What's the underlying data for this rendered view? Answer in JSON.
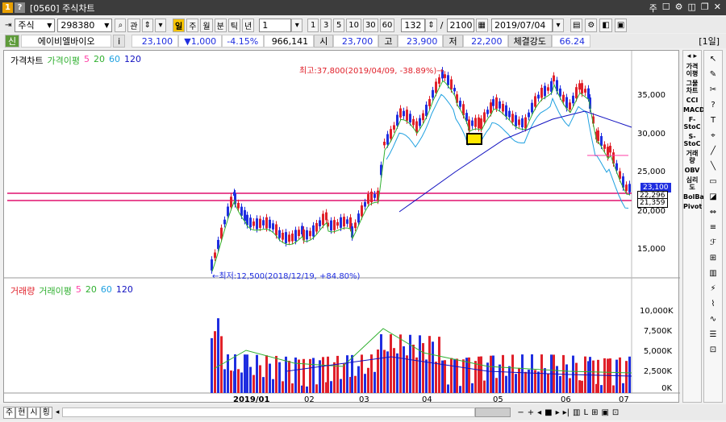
{
  "window": {
    "title": "[0560] 주식차트",
    "id_icon": "1",
    "help_icon": "?",
    "right_controls": [
      "주",
      "☐",
      "⚙",
      "◫",
      "❐",
      "✕"
    ]
  },
  "toolbar": {
    "market": "주식",
    "code": "298380",
    "quick_label": "관",
    "period_options": [
      "주",
      "월",
      "분",
      "틱",
      "년"
    ],
    "period_active": "일",
    "period_input": "1",
    "minute_options": [
      "1",
      "3",
      "5",
      "10",
      "30",
      "60"
    ],
    "count": "132",
    "total": "2100",
    "date": "2019/07/04"
  },
  "quote": {
    "badge": "신",
    "name": "에이비엘바이오",
    "info": "i",
    "price": "23,100",
    "change": "▼1,000",
    "rate": "-4.15%",
    "volume": "966,141",
    "open_label": "시",
    "open": "23,700",
    "high_label": "고",
    "high": "23,900",
    "low_label": "저",
    "low": "22,200",
    "strength_label": "체결강도",
    "strength": "66.24",
    "period_tag": "[1일]"
  },
  "price_panel": {
    "title": "가격차트",
    "ma_label": "가격이평",
    "ma": [
      "5",
      "20",
      "60",
      "120"
    ],
    "max_note": "최고:37,800(2019/04/09, -38.89%)→",
    "min_note": "←최저:12,500(2018/12/19, +84.80%)",
    "y_ticks": [
      "35,000",
      "30,000",
      "25,000",
      "20,000",
      "15,000"
    ],
    "last_tag": "23,100",
    "line1_tag": "22,296",
    "line2_tag": "21,359"
  },
  "volume_panel": {
    "title": "거래량",
    "ma_label": "거래이평",
    "ma": [
      "5",
      "20",
      "60",
      "120"
    ],
    "y_ticks": [
      "10,000K",
      "7,500K",
      "5,000K",
      "2,500K",
      "0K"
    ]
  },
  "x_axis": [
    "2019/01",
    "02",
    "03",
    "04",
    "05",
    "06",
    "07"
  ],
  "sidebar_indicators": [
    "가격이평",
    "그물차트",
    "CCI",
    "MACD",
    "F-StoC",
    "S-StoC",
    "거래량",
    "OBV",
    "심리도",
    "BolBand",
    "Pivot"
  ],
  "sidebar_tools": [
    "↖",
    "✎",
    "✂",
    "?",
    "T",
    "⌖",
    "╱",
    "╲",
    "▭",
    "◪",
    "⇔",
    "≡",
    "ℱ",
    "⊞",
    "▥",
    "⚡",
    "⌇",
    "∿",
    "☰",
    "⊡",
    "▦",
    "▤",
    "▧"
  ],
  "bottom": {
    "tabs": [
      "주",
      "현",
      "시",
      "횡"
    ]
  },
  "colors": {
    "up": "#e0202a",
    "down": "#1f2ee0",
    "ma5": "#ff3ea5",
    "ma20": "#30b030",
    "ma60": "#1ea0e0",
    "ma120": "#1010c0",
    "hline": "#e0106e"
  }
}
